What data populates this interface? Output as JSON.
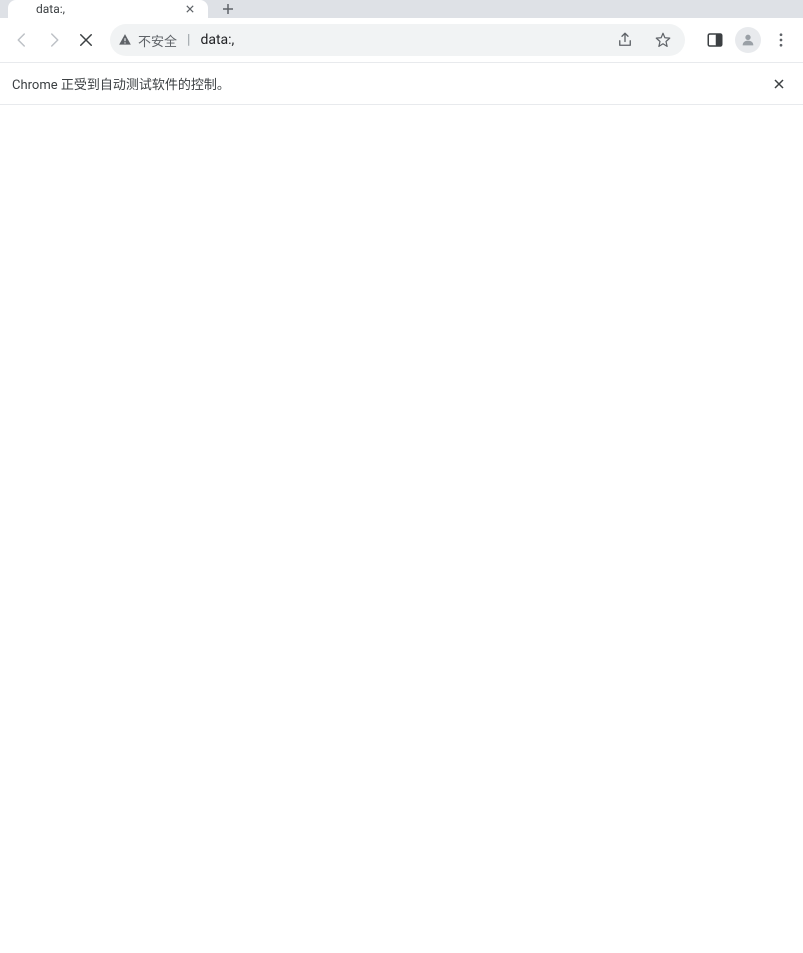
{
  "tab": {
    "title": "data:,"
  },
  "omnibox": {
    "security_label": "不安全",
    "url": "data:,"
  },
  "infobar": {
    "message": "Chrome 正受到自动测试软件的控制。"
  }
}
